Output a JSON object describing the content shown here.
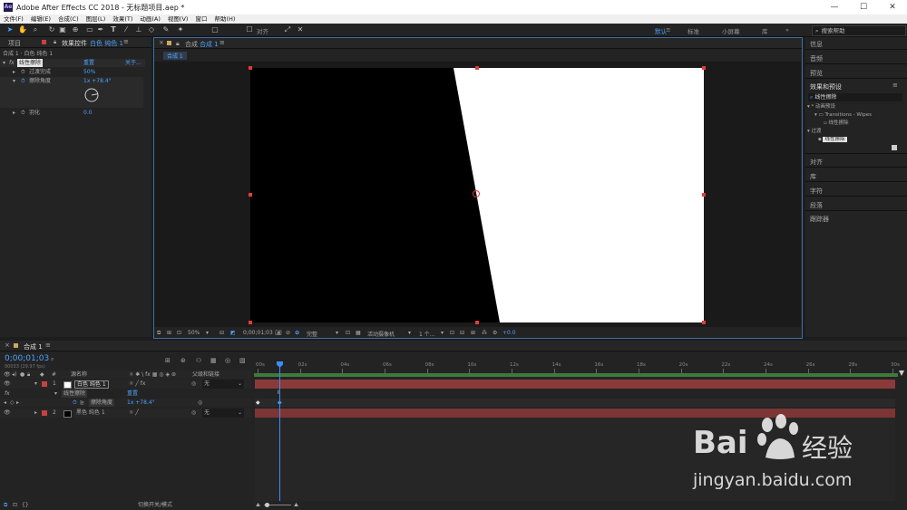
{
  "window": {
    "title": "Adobe After Effects CC 2018 - 无标题项目.aep *",
    "logo": "Ae",
    "minimize": "—",
    "maximize": "☐",
    "close": "✕"
  },
  "menu": [
    "文件(F)",
    "编辑(E)",
    "合成(C)",
    "图层(L)",
    "效果(T)",
    "动画(A)",
    "视图(V)",
    "窗口",
    "帮助(H)"
  ],
  "toolbar": {
    "align_label": "对齐",
    "workspaces": [
      "默认",
      "标准",
      "小屏幕",
      "库"
    ],
    "search_placeholder": "搜索帮助"
  },
  "left_panel": {
    "tab_project": "项目",
    "tab_effects": "效果控件",
    "tab_effects_layer": "白色 纯色 1",
    "breadcrumb": "合成 1 · 白色 纯色 1",
    "effect_name": "线性擦除",
    "effect_reset": "重置",
    "effect_about": "关于...",
    "props": [
      {
        "name": "过渡完成",
        "value": "50%"
      },
      {
        "name": "擦除角度",
        "value": "1x +78.4°"
      },
      {
        "name": "羽化",
        "value": "0.0"
      }
    ]
  },
  "comp_panel": {
    "tab": "合成 1",
    "subtab": "合成 1",
    "zoom": "50%",
    "timecode": "0;00;01;03",
    "resolution": "完整",
    "camera": "活动摄像机",
    "views": "1 个...",
    "exposure": "+0.0"
  },
  "right_panel": {
    "items_top": [
      "信息",
      "音频",
      "预览"
    ],
    "effects_presets_title": "效果和预设",
    "search_value": "线性擦除",
    "tree": [
      {
        "label": "* 动画预设",
        "level": 0
      },
      {
        "label": "Transitions - Wipes",
        "level": 1
      },
      {
        "label": "线性擦除",
        "level": 2
      },
      {
        "label": "过渡",
        "level": 0
      },
      {
        "label": "线性擦除",
        "level": 1
      }
    ],
    "items_bottom": [
      "对齐",
      "库",
      "字符",
      "段落",
      "跟踪器"
    ]
  },
  "timeline": {
    "tab": "合成 1",
    "timecode": "0;00;01;03",
    "frames": "00033 (29.97 fps)",
    "col_source": "源名称",
    "col_parent": "父级和链接",
    "ruler": [
      "00s",
      "02s",
      "04s",
      "06s",
      "08s",
      "10s",
      "12s",
      "14s",
      "16s",
      "18s",
      "20s",
      "22s",
      "24s",
      "26s",
      "28s",
      "30s"
    ],
    "layers": [
      {
        "num": "1",
        "name": "白色 纯色 1",
        "parent": "无",
        "color": "#c94040",
        "swatch": "#ffffff"
      },
      {
        "num": "2",
        "name": "黑色 纯色 1",
        "parent": "无",
        "color": "#c94040",
        "swatch": "#000000"
      }
    ],
    "effect_row": "线性擦除",
    "effect_reset": "重置",
    "prop_row": "擦除角度",
    "prop_value": "1x +78.4°",
    "fx_label": "fx",
    "footer_toggle": "切换开关/模式"
  },
  "watermark": {
    "brand": "Bai",
    "brand2": "经验",
    "url": "jingyan.baidu.com"
  }
}
